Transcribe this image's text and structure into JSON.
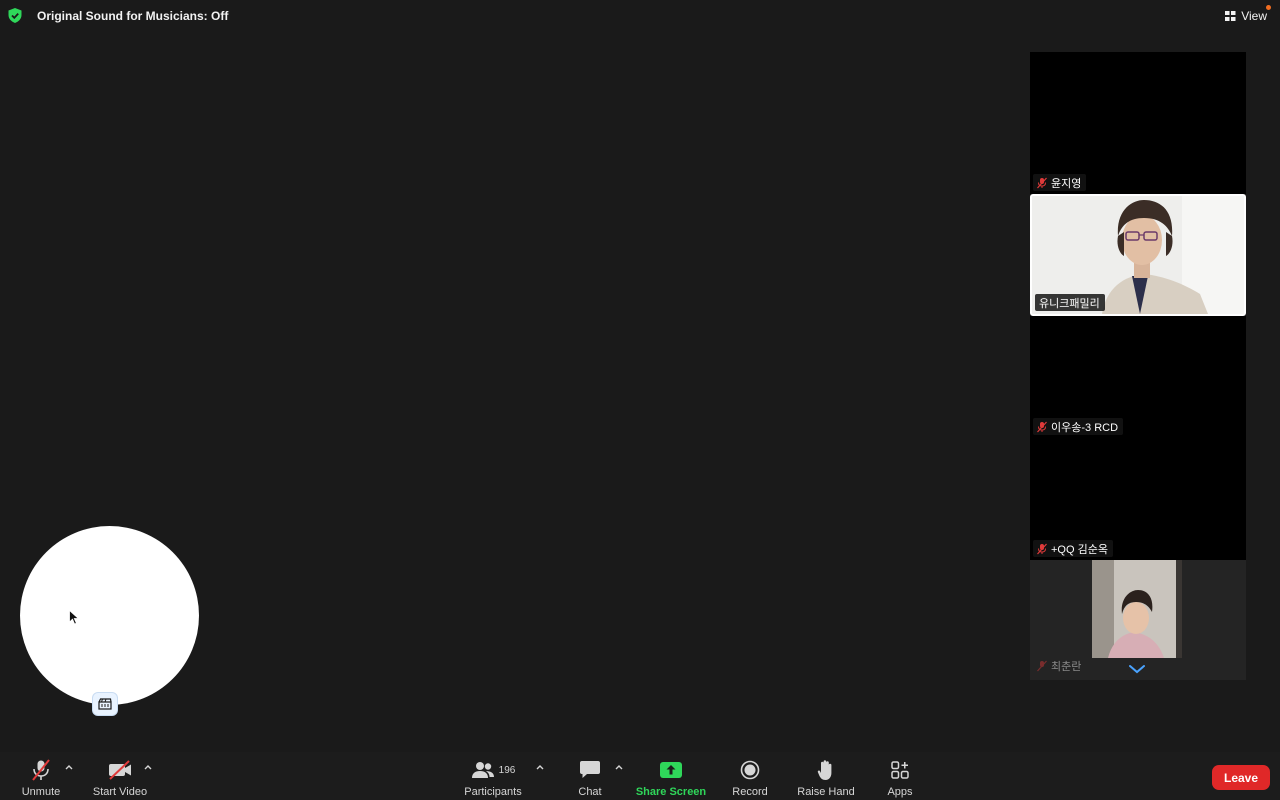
{
  "topbar": {
    "sound_status": "Original Sound for Musicians: Off",
    "view_label": "View",
    "shield_color": "#2fd75a",
    "view_badge_color": "#f26d21"
  },
  "gallery": {
    "tiles": [
      {
        "name": "윤지영",
        "muted": true,
        "video": false
      },
      {
        "name": "유니크패밀리",
        "muted": false,
        "video": true,
        "active_speaker": true
      },
      {
        "name": "이우송-3 RCD",
        "muted": true,
        "video": false
      },
      {
        "name": "+QQ  김순옥",
        "muted": true,
        "video": false
      },
      {
        "name": "최춘란",
        "muted": true,
        "video": true
      }
    ],
    "scroll_icon": "chevron-down-icon"
  },
  "self_view": {
    "button_icon": "movie-clapper-icon"
  },
  "toolbar": {
    "unmute_label": "Unmute",
    "start_video_label": "Start Video",
    "participants_label": "Participants",
    "participants_count": "196",
    "chat_label": "Chat",
    "share_screen_label": "Share Screen",
    "record_label": "Record",
    "raise_hand_label": "Raise Hand",
    "apps_label": "Apps",
    "leave_label": "Leave",
    "leave_color": "#e02828",
    "share_color": "#2fd75a"
  }
}
